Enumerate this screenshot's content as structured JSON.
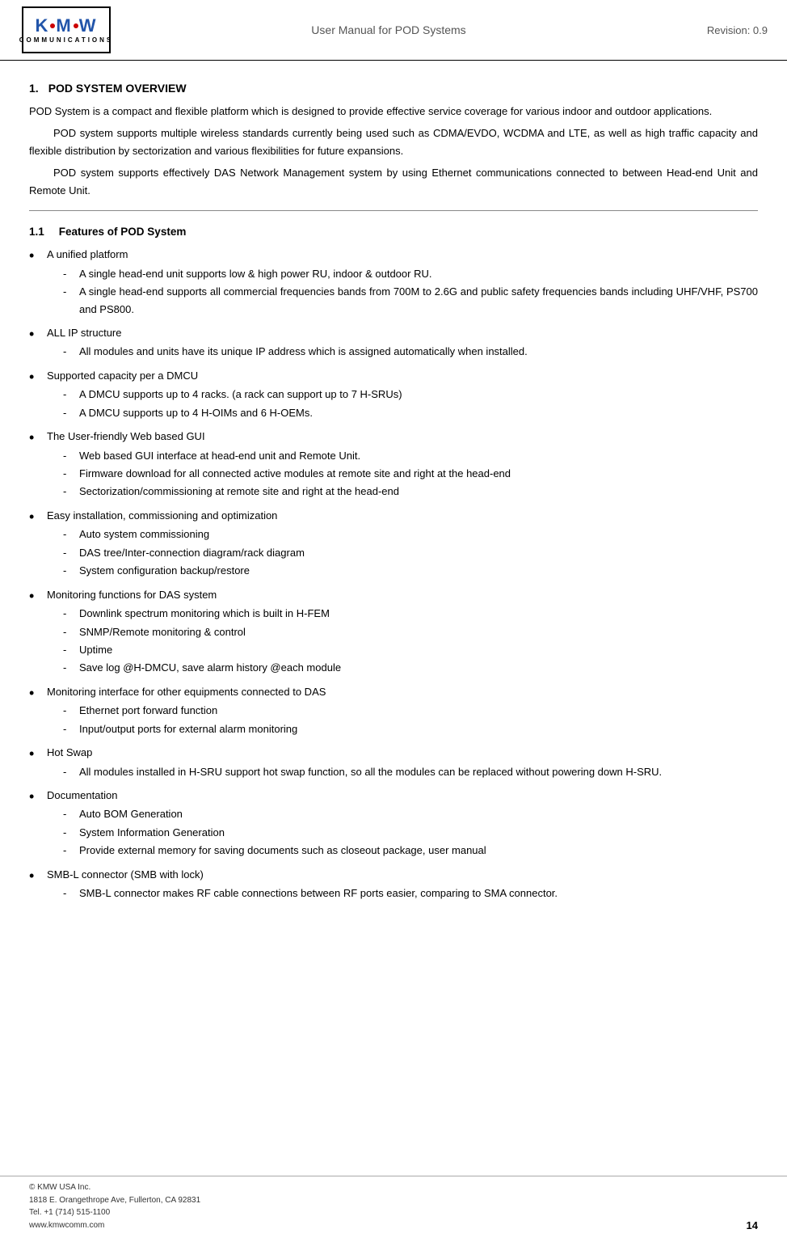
{
  "header": {
    "title": "User Manual for POD Systems",
    "revision": "Revision: 0.9",
    "logo": {
      "brand": "KMW",
      "subtitle": "COMMUNICATIONS"
    }
  },
  "section1": {
    "number": "1.",
    "title": "POD SYSTEM OVERVIEW",
    "para1": "POD System is a compact and flexible platform which is designed to provide effective service coverage for various indoor and outdoor applications.",
    "para2": "POD system supports multiple wireless standards currently being used such as CDMA/EVDO, WCDMA and LTE, as well as high traffic capacity and flexible distribution by sectorization and various flexibilities for future expansions.",
    "para3": "POD system supports effectively DAS Network Management system by using Ethernet communications connected to between Head-end Unit and Remote Unit."
  },
  "section1_1": {
    "number": "1.1",
    "title": "Features of POD System"
  },
  "bullets": [
    {
      "label": "A unified platform",
      "sub": [
        "A single head-end unit supports low & high power RU, indoor & outdoor RU.",
        "A single head-end supports all commercial frequencies bands from 700M to 2.6G and public safety frequencies bands including UHF/VHF, PS700 and PS800."
      ]
    },
    {
      "label": "ALL IP structure",
      "sub": [
        "All modules and units have its unique IP address which is assigned automatically when installed."
      ]
    },
    {
      "label": "Supported capacity per a DMCU",
      "sub": [
        "A DMCU supports up to 4 racks. (a rack can support up to 7 H-SRUs)",
        "A DMCU supports up to 4 H-OIMs and 6 H-OEMs."
      ]
    },
    {
      "label": "The User-friendly Web based GUI",
      "sub": [
        "Web based GUI interface at head-end unit and Remote Unit.",
        "Firmware download for all connected active modules at remote site and right at the head-end",
        "Sectorization/commissioning at remote site and right at the head-end"
      ]
    },
    {
      "label": "Easy installation, commissioning and optimization",
      "sub": [
        "Auto system commissioning",
        "DAS tree/Inter-connection diagram/rack diagram",
        "System configuration backup/restore"
      ]
    },
    {
      "label": "Monitoring functions for DAS system",
      "sub": [
        "Downlink spectrum monitoring which is built in H-FEM",
        "SNMP/Remote monitoring & control",
        "Uptime",
        "Save log @H-DMCU, save alarm history @each module"
      ]
    },
    {
      "label": "Monitoring interface for other equipments connected to DAS",
      "sub": [
        "Ethernet port forward function",
        "Input/output ports for external alarm monitoring"
      ]
    },
    {
      "label": "Hot Swap",
      "sub": [
        "All modules installed in H-SRU support hot swap function, so all the modules can be replaced without powering down H-SRU."
      ]
    },
    {
      "label": "Documentation",
      "sub": [
        "Auto BOM Generation",
        "System Information Generation",
        "Provide external memory for saving documents such as closeout package, user manual"
      ]
    },
    {
      "label": "SMB-L connector (SMB with lock)",
      "sub": [
        "SMB-L connector makes RF cable connections between RF ports easier, comparing to SMA connector."
      ]
    }
  ],
  "footer": {
    "company": "© KMW USA Inc.",
    "address": "1818 E. Orangethrope Ave, Fullerton, CA 92831",
    "tel": "Tel. +1 (714) 515-1100",
    "web": "www.kmwcomm.com",
    "page": "14"
  }
}
